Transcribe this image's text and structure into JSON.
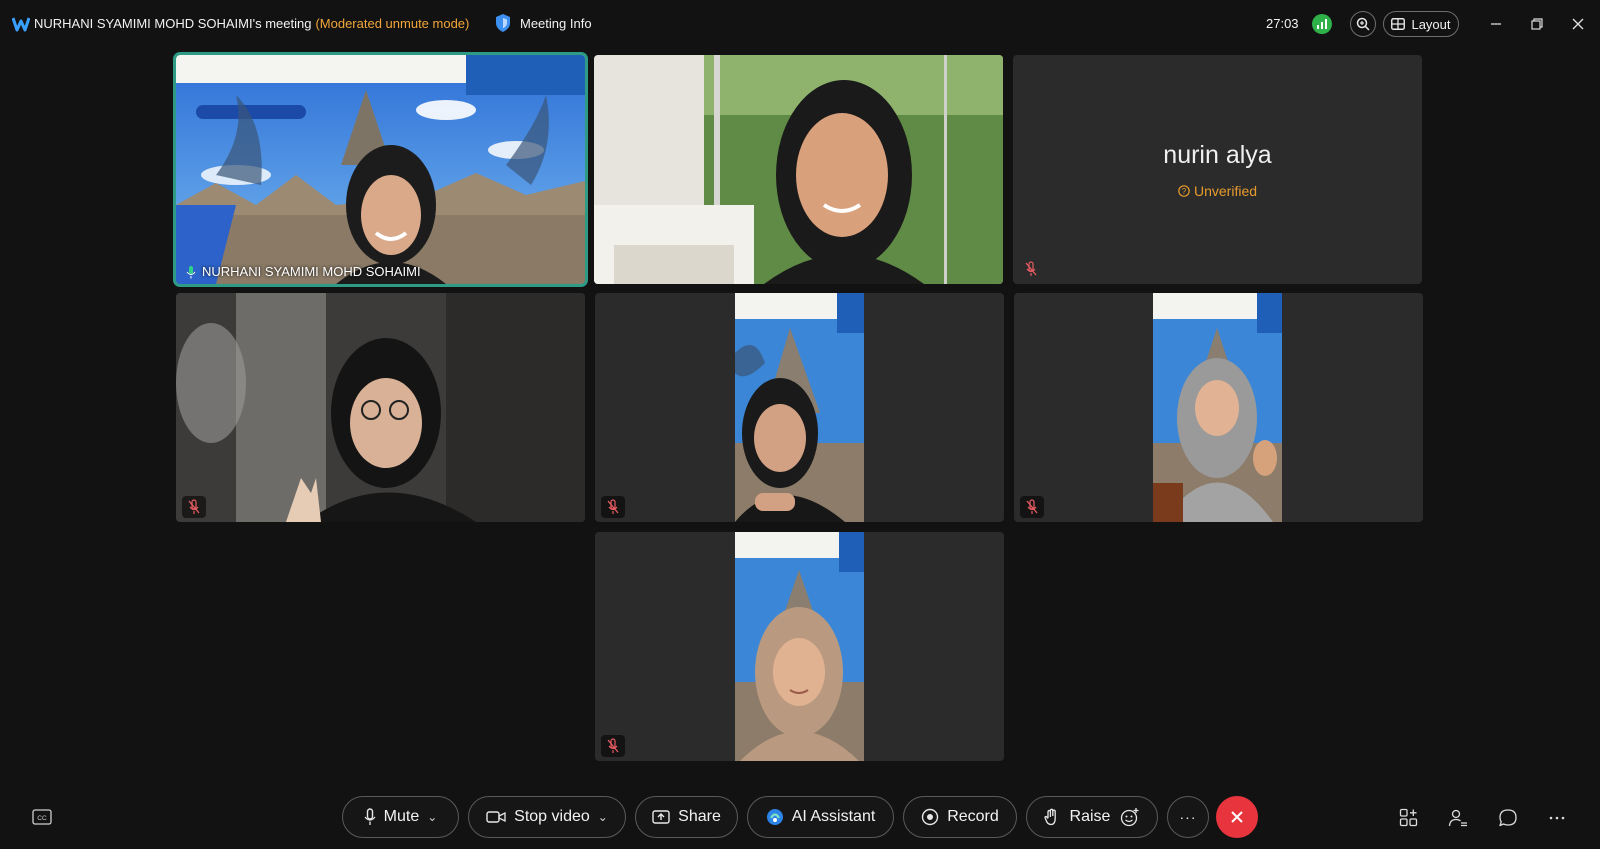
{
  "titlebar": {
    "meeting_title": "NURHANI SYAMIMI MOHD SOHAIMI's meeting",
    "mode": "(Moderated unmute mode)",
    "meeting_info": "Meeting Info",
    "timer": "27:03",
    "layout": "Layout"
  },
  "tiles": {
    "host_name": "NURHANI SYAMIMI MOHD SOHAIMI",
    "nurin_name": "nurin alya",
    "nurin_status": "Unverified"
  },
  "controls": {
    "mute": "Mute",
    "stop_video": "Stop video",
    "share": "Share",
    "ai_assistant": "AI Assistant",
    "record": "Record",
    "raise": "Raise",
    "more": "···"
  },
  "colors": {
    "background": "#121212",
    "active_speaker": "#2e9c85",
    "warning": "#f2a53a",
    "leave": "#e8343c"
  }
}
